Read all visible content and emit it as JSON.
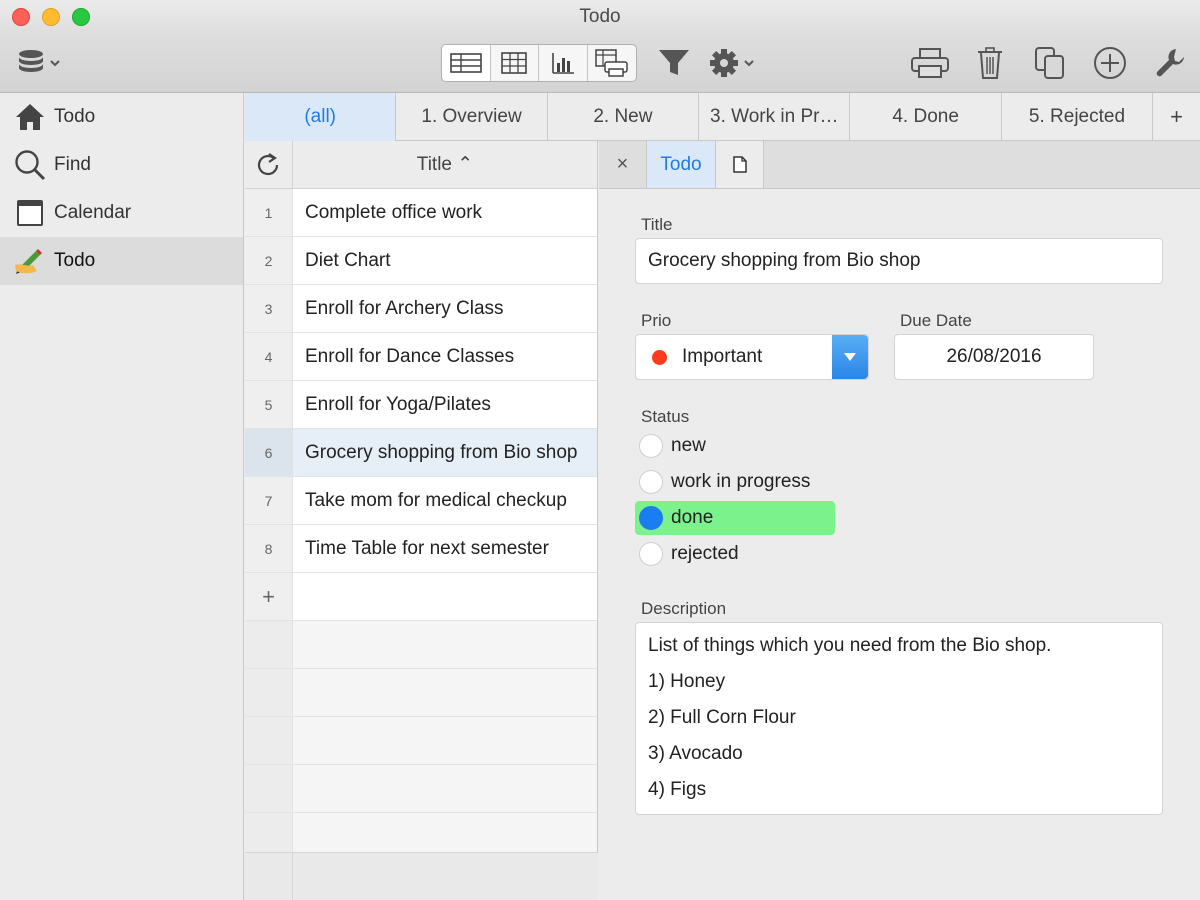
{
  "window": {
    "title": "Todo"
  },
  "toolbar": {
    "left_icon": "database-icon",
    "view_buttons": [
      "form-view-icon",
      "table-view-icon",
      "chart-view-icon",
      "print-view-icon"
    ],
    "filter_icon": "filter-icon",
    "settings_icon": "gear-icon",
    "right_icons": [
      "printer-icon",
      "trash-icon",
      "duplicate-icon",
      "add-icon",
      "wrench-icon"
    ]
  },
  "sidebar": {
    "items": [
      {
        "label": "Todo",
        "icon": "home-icon"
      },
      {
        "label": "Find",
        "icon": "search-icon"
      },
      {
        "label": "Calendar",
        "icon": "calendar-icon"
      },
      {
        "label": "Todo",
        "icon": "pencil-hand-icon"
      }
    ]
  },
  "tabs": {
    "items": [
      "(all)",
      "1. Overview",
      "2. New",
      "3. Work in Pr…",
      "4. Done",
      "5. Rejected"
    ],
    "add_label": "+"
  },
  "list": {
    "header_title": "Title ⌃",
    "rows": [
      {
        "num": "1",
        "title": "Complete office work"
      },
      {
        "num": "2",
        "title": "Diet Chart"
      },
      {
        "num": "3",
        "title": "Enroll for Archery Class"
      },
      {
        "num": "4",
        "title": "Enroll for Dance Classes"
      },
      {
        "num": "5",
        "title": "Enroll for Yoga/Pilates"
      },
      {
        "num": "6",
        "title": "Grocery shopping from Bio shop"
      },
      {
        "num": "7",
        "title": "Take mom for medical checkup"
      },
      {
        "num": "8",
        "title": "Time Table for next semester"
      }
    ],
    "add_label": "+"
  },
  "detail": {
    "close_label": "×",
    "tab_label": "Todo",
    "title_label": "Title",
    "title_value": "Grocery shopping from Bio shop",
    "prio_label": "Prio",
    "prio_value": "Important",
    "prio_color": "#fe3b1f",
    "due_label": "Due Date",
    "due_value": "26/08/2016",
    "status_label": "Status",
    "status_options": [
      "new",
      "work in progress",
      "done",
      "rejected"
    ],
    "status_selected": "done",
    "status_highlight_color": "#7cf28c",
    "description_label": "Description",
    "description_lines": [
      "List of things which you need from the Bio shop.",
      "1) Honey",
      "2) Full Corn Flour",
      "3) Avocado",
      "4) Figs"
    ]
  },
  "colors": {
    "accent": "#1e7ce6",
    "selected_tab_bg": "#dbe8f7"
  }
}
